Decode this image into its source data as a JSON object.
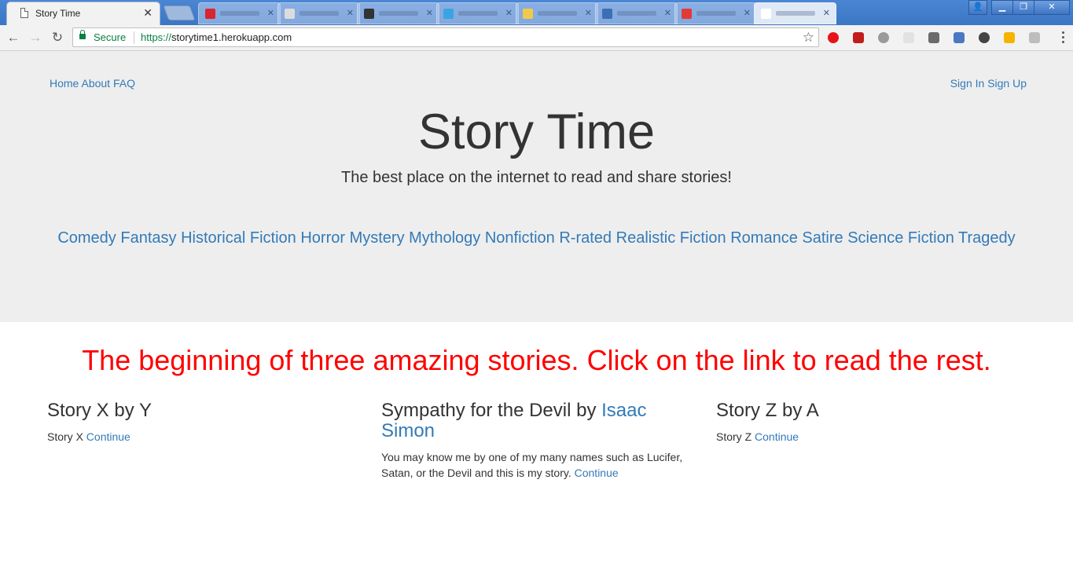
{
  "browser": {
    "active_tab_title": "Story Time",
    "url_secure_label": "Secure",
    "url_scheme": "https://",
    "url_host": "storytime1.herokuapp.com",
    "background_tabs": [
      {
        "favicon_color": "#d7262d"
      },
      {
        "favicon_color": "#dcdcdc"
      },
      {
        "favicon_color": "#333333"
      },
      {
        "favicon_color": "#3aa3e3"
      },
      {
        "favicon_color": "#f2c94c"
      },
      {
        "favicon_color": "#3d6fb5"
      },
      {
        "favicon_color": "#e53935"
      },
      {
        "favicon_color": "#ffffff"
      }
    ],
    "extensions": [
      {
        "name": "opera-icon",
        "color": "#e8121a"
      },
      {
        "name": "adblock-icon",
        "color": "#c21d1d"
      },
      {
        "name": "ublock-icon",
        "color": "#9a9a9a"
      },
      {
        "name": "blank-extension-icon",
        "color": "#e2e2e2"
      },
      {
        "name": "angular-icon",
        "color": "#6b6b6b"
      },
      {
        "name": "screenshot-icon",
        "color": "#4a78c2"
      },
      {
        "name": "spiral-icon",
        "color": "#444444"
      },
      {
        "name": "google-drive-icon",
        "color": "#f4b400"
      },
      {
        "name": "gear-extension-icon",
        "color": "#bdbdbd"
      }
    ]
  },
  "nav": {
    "left": [
      "Home",
      "About",
      "FAQ"
    ],
    "right": [
      "Sign In",
      "Sign Up"
    ]
  },
  "hero": {
    "title": "Story Time",
    "tagline": "The best place on the internet to read and share stories!"
  },
  "genres": [
    "Comedy",
    "Fantasy",
    "Historical Fiction",
    "Horror",
    "Mystery",
    "Mythology",
    "Nonfiction",
    "R-rated",
    "Realistic Fiction",
    "Romance",
    "Satire",
    "Science Fiction",
    "Tragedy"
  ],
  "headline": "The beginning of three amazing stories. Click on the link to read the rest.",
  "stories": [
    {
      "title": "Story X by Y",
      "author_link": "",
      "excerpt": "Story X",
      "continue": "Continue"
    },
    {
      "title": "Sympathy for the Devil by ",
      "author_link": "Isaac Simon",
      "excerpt": "You may know me by one of my many names such as Lucifer, Satan, or the Devil and this is my story.",
      "continue": "Continue"
    },
    {
      "title": "Story Z by A",
      "author_link": "",
      "excerpt": "Story Z",
      "continue": "Continue"
    }
  ],
  "colors": {
    "link": "#337ab7",
    "headline": "#ff0000",
    "jumbotron_bg": "#eeeeee",
    "secure_green": "#0b8043"
  }
}
